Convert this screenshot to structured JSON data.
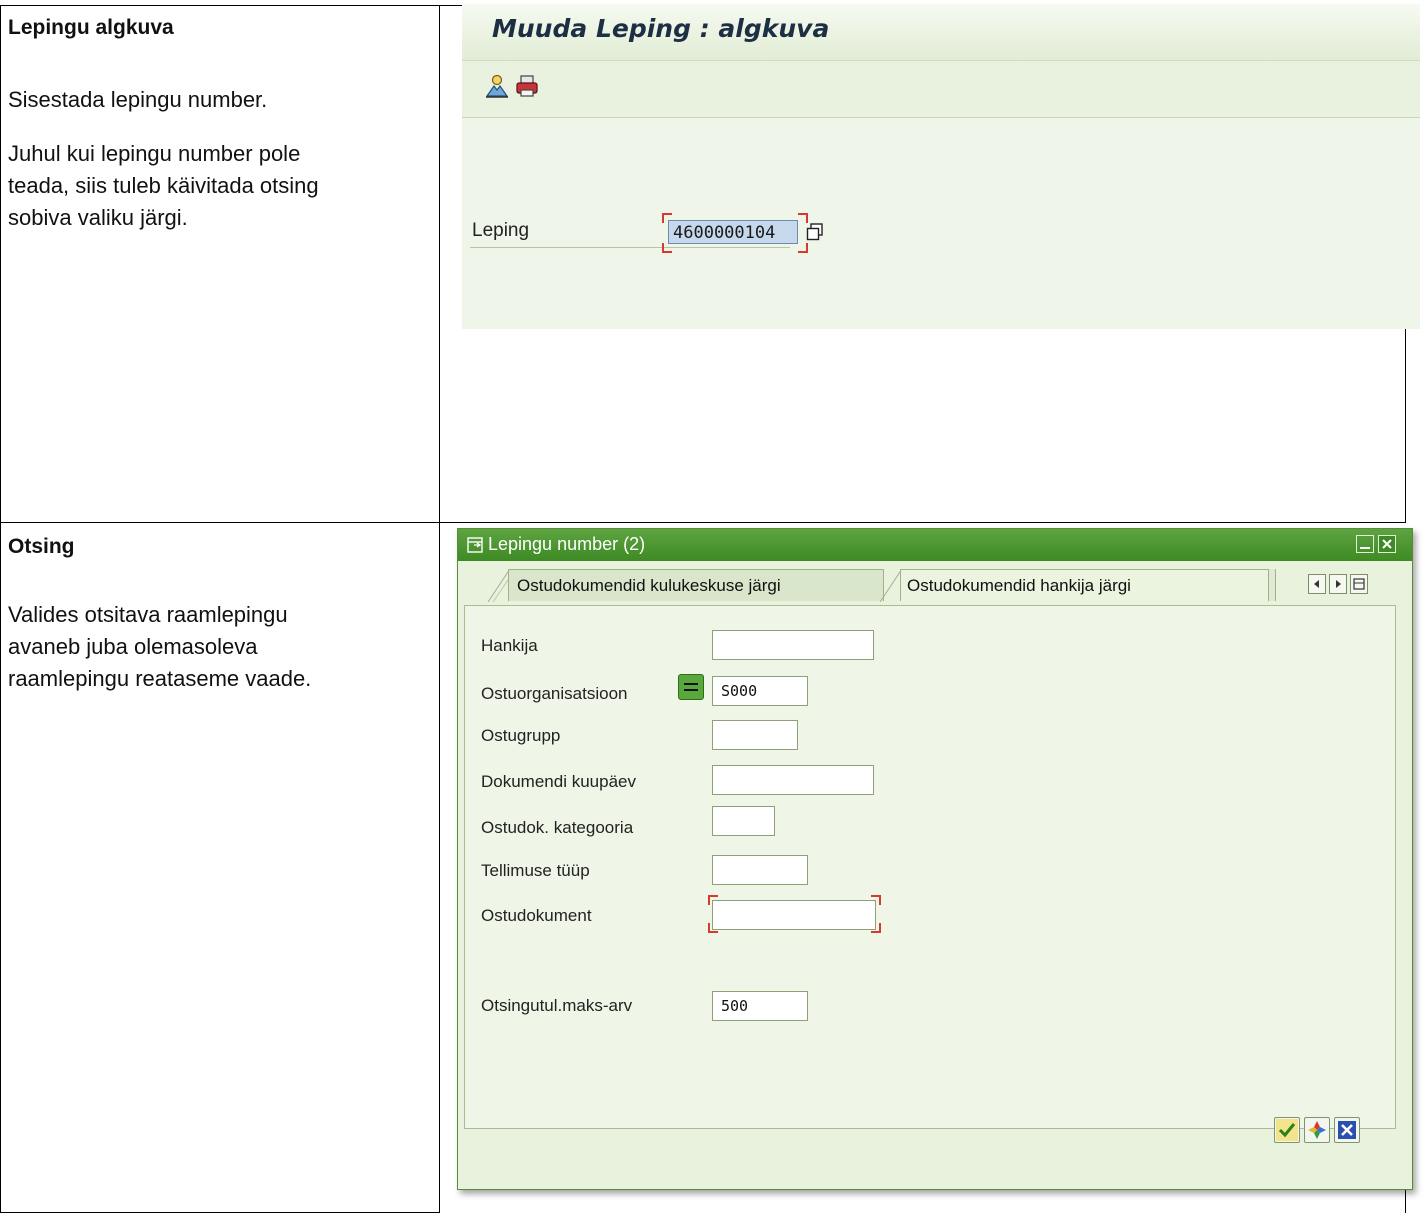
{
  "doc": {
    "row1": {
      "heading": "Lepingu algkuva",
      "para1": "Sisestada lepingu number.",
      "para2_l1": "Juhul kui lepingu number pole",
      "para2_l2": "teada, siis tuleb käivitada otsing",
      "para2_l3": "sobiva valiku järgi."
    },
    "row2": {
      "heading": "Otsing",
      "para_l1": "Valides otsitava raamlepingu",
      "para_l2": "avaneb juba olemasoleva",
      "para_l3": "raamlepingu reataseme vaade."
    }
  },
  "screen1": {
    "title": "Muuda Leping : algkuva",
    "toolbar": {
      "icons": [
        "other-object-icon",
        "print-icon"
      ]
    },
    "field_label": "Leping",
    "field_value": "4600000104"
  },
  "dialog": {
    "title": "Lepingu number (2)",
    "tabs": [
      {
        "label": "Ostudokumendid kulukeskuse järgi",
        "active": false
      },
      {
        "label": "Ostudokumendid hankija järgi",
        "active": true
      }
    ],
    "fields": [
      {
        "label": "Hankija",
        "value": ""
      },
      {
        "label": "Ostuorganisatsioon",
        "value": "S000"
      },
      {
        "label": "Ostugrupp",
        "value": ""
      },
      {
        "label": "Dokumendi kuupäev",
        "value": ""
      },
      {
        "label": "Ostudok. kategooria",
        "value": ""
      },
      {
        "label": "Tellimuse tüüp",
        "value": ""
      },
      {
        "label": "Ostudokument",
        "value": ""
      },
      {
        "label": "Otsingutul.maks-arv",
        "value": "500"
      }
    ],
    "footer_buttons": [
      "confirm-check-icon",
      "multiple-selection-icon",
      "cancel-icon"
    ]
  },
  "colors": {
    "title_bar_green": "#4f9a33",
    "screen_bg": "#eff5e8",
    "required_marker": "#d63a2c",
    "field_highlight": "#c6d8ec"
  }
}
